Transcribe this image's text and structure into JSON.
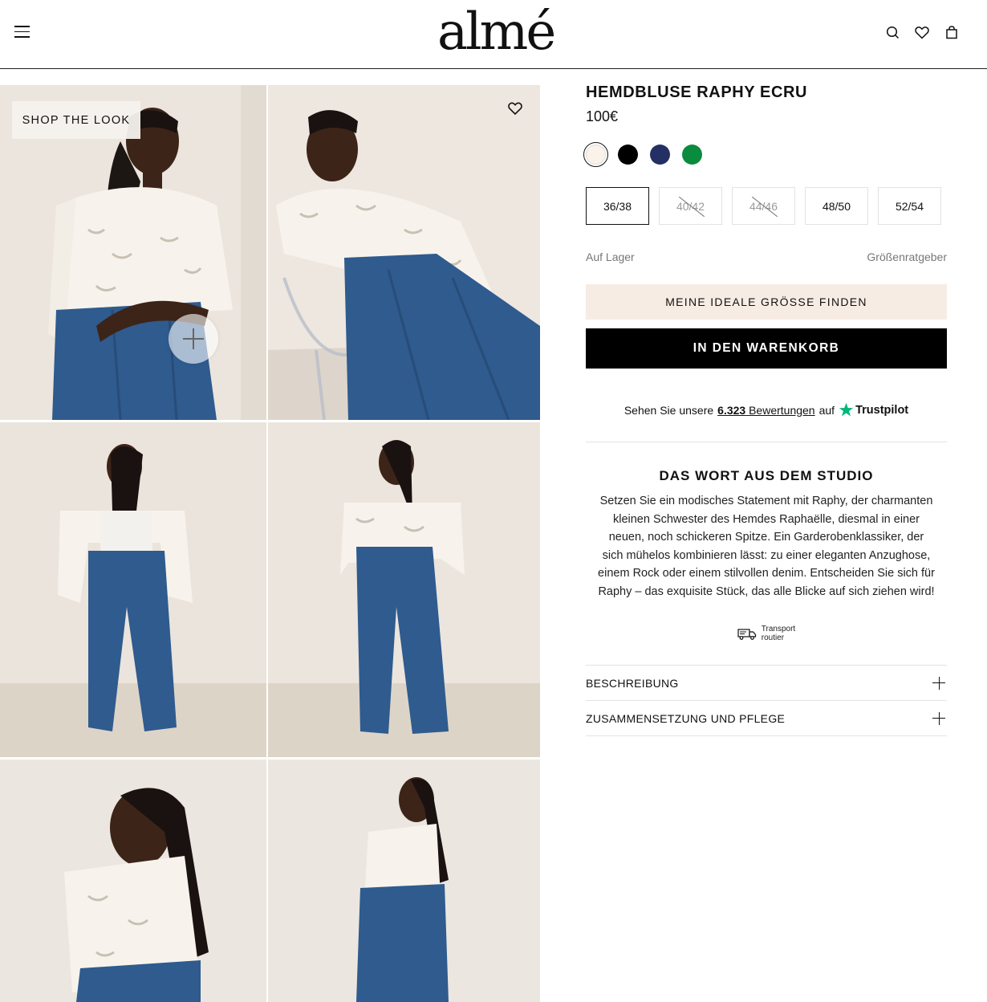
{
  "header": {
    "logo": "almé",
    "icons": [
      "menu-icon",
      "search-icon",
      "heart-icon",
      "bag-icon"
    ]
  },
  "gallery": {
    "shop_the_look": "SHOP THE LOOK",
    "photos": [
      "model-photo-front-closeup",
      "model-photo-seated",
      "model-photo-open-shirt",
      "model-photo-full-front",
      "model-photo-side",
      "model-photo-back"
    ]
  },
  "product": {
    "title": "HEMDBLUSE RAPHY ECRU",
    "price": "100€",
    "colors": [
      {
        "name": "ecru",
        "hex": "#fbf3ea",
        "active": true
      },
      {
        "name": "black",
        "hex": "#000000"
      },
      {
        "name": "navy",
        "hex": "#243063"
      },
      {
        "name": "green",
        "hex": "#0b8b3d"
      }
    ],
    "sizes": [
      {
        "label": "36/38",
        "status": "selected"
      },
      {
        "label": "40/42",
        "status": "sold-out"
      },
      {
        "label": "44/46",
        "status": "sold-out"
      },
      {
        "label": "48/50",
        "status": "available"
      },
      {
        "label": "52/54",
        "status": "available"
      }
    ],
    "stock": "Auf Lager",
    "size_guide": "Größenratgeber",
    "find_size_button": "MEINE IDEALE GRÖSSE FINDEN",
    "add_to_cart_button": "IN DEN WARENKORB"
  },
  "reviews": {
    "prefix": "Sehen Sie unsere",
    "count": "6.323",
    "link_label": "Bewertungen",
    "suffix": "auf",
    "brand": "Trustpilot",
    "brand_color": "#00b67a"
  },
  "studio": {
    "title": "DAS WORT AUS DEM STUDIO",
    "text": "Setzen Sie ein modisches Statement mit Raphy, der charmanten kleinen Schwester des Hemdes Raphaëlle, diesmal in einer neuen, noch schickeren Spitze. Ein Garderobenklassiker, der sich mühelos kombinieren lässt: zu einer eleganten Anzughose, einem Rock oder einem stilvollen denim. Entscheiden Sie sich für Raphy – das exquisite Stück, das alle Blicke auf sich ziehen wird!",
    "transport_line1": "Transport",
    "transport_line2": "routier"
  },
  "accordion": [
    {
      "label": "BESCHREIBUNG"
    },
    {
      "label": "ZUSAMMENSETZUNG UND PFLEGE"
    }
  ]
}
